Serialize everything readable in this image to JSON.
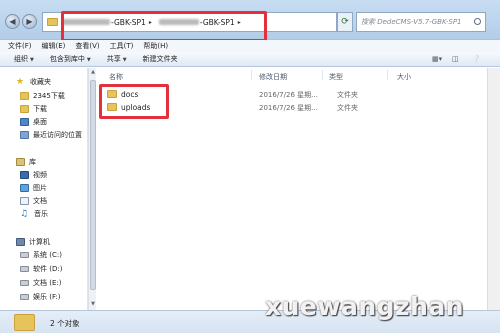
{
  "address": {
    "crumb1": "-GBK-SP1",
    "crumb2": "-GBK-SP1",
    "sep": "▸"
  },
  "search": {
    "placeholder": "搜索 DedeCMS-V5.7-GBK-SP1"
  },
  "menu": [
    "文件(F)",
    "编辑(E)",
    "查看(V)",
    "工具(T)",
    "帮助(H)"
  ],
  "toolbar": {
    "organize": "组织",
    "include": "包含到库中",
    "share": "共享",
    "new_folder": "新建文件夹"
  },
  "sidebar": {
    "favorites": "收藏夹",
    "fav_items": [
      "2345下载",
      "下载",
      "桌面",
      "最近访问的位置"
    ],
    "library": "库",
    "lib_items": [
      "视频",
      "图片",
      "文档",
      "音乐"
    ],
    "computer": "计算机",
    "drives": [
      "系统 (C:)",
      "软件 (D:)",
      "文档 (E:)",
      "娱乐 (F:)"
    ]
  },
  "columns": {
    "name": "名称",
    "date": "修改日期",
    "type": "类型",
    "size": "大小"
  },
  "files": [
    {
      "name": "docs",
      "date": "2016/7/26 星期...",
      "type": "文件夹"
    },
    {
      "name": "uploads",
      "date": "2016/7/26 星期...",
      "type": "文件夹"
    }
  ],
  "status": {
    "text": "2 个对象"
  },
  "watermark": "xuewangzhan",
  "colors": {
    "highlight_box": "#e2313b",
    "folder": "#e7c45b"
  }
}
